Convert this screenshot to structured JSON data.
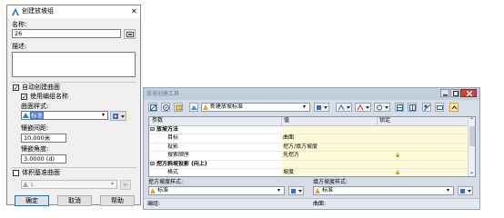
{
  "dialog": {
    "title": "创建放坡组",
    "close_glyph": "✕",
    "name_label": "名称:",
    "name_value": "26",
    "desc_label": "描述:",
    "auto_create_label": "自动创建曲面",
    "auto_create_checked": true,
    "use_group_name_label": "使用编组名称",
    "use_group_name_checked": true,
    "surface_style_label": "曲面样式:",
    "surface_style_value": "标准",
    "tessellation_spacing_label": "镶嵌间距:",
    "tessellation_spacing_value": "10.000米",
    "tessellation_angle_label": "镶嵌角度:",
    "tessellation_angle_value": "3.0000 (d)",
    "volume_base_label": "体积基准曲面",
    "volume_base_checked": false,
    "volume_base_value": "1",
    "ok_label": "确定",
    "cancel_label": "取消",
    "help_label": "帮助"
  },
  "toolbar_window": {
    "title": "放坡创建工具",
    "criteria_value": "新建放坡标准",
    "columns": {
      "param": "参数",
      "value": "值",
      "lock": "锁定"
    },
    "rows": [
      {
        "kind": "group",
        "param": "放坡方法",
        "value": "",
        "lock": ""
      },
      {
        "kind": "item",
        "param": "目标",
        "value": "曲面",
        "lock": ""
      },
      {
        "kind": "item",
        "param": "投影",
        "value": "挖方/填方坡度",
        "lock": ""
      },
      {
        "kind": "item",
        "param": "搜索顺序",
        "value": "先挖方",
        "lock": "🔒"
      },
      {
        "kind": "group",
        "param": "挖方斜坡投影 (向上)",
        "value": "",
        "lock": ""
      },
      {
        "kind": "item",
        "param": "格式",
        "value": "坡度",
        "lock": "🔒"
      }
    ],
    "cut_style_label": "挖方坡度样式:",
    "cut_style_value": "标准",
    "fill_style_label": "填方坡度样式:",
    "fill_style_value": "标准",
    "status_left": "编组:",
    "status_right": "曲面:"
  }
}
